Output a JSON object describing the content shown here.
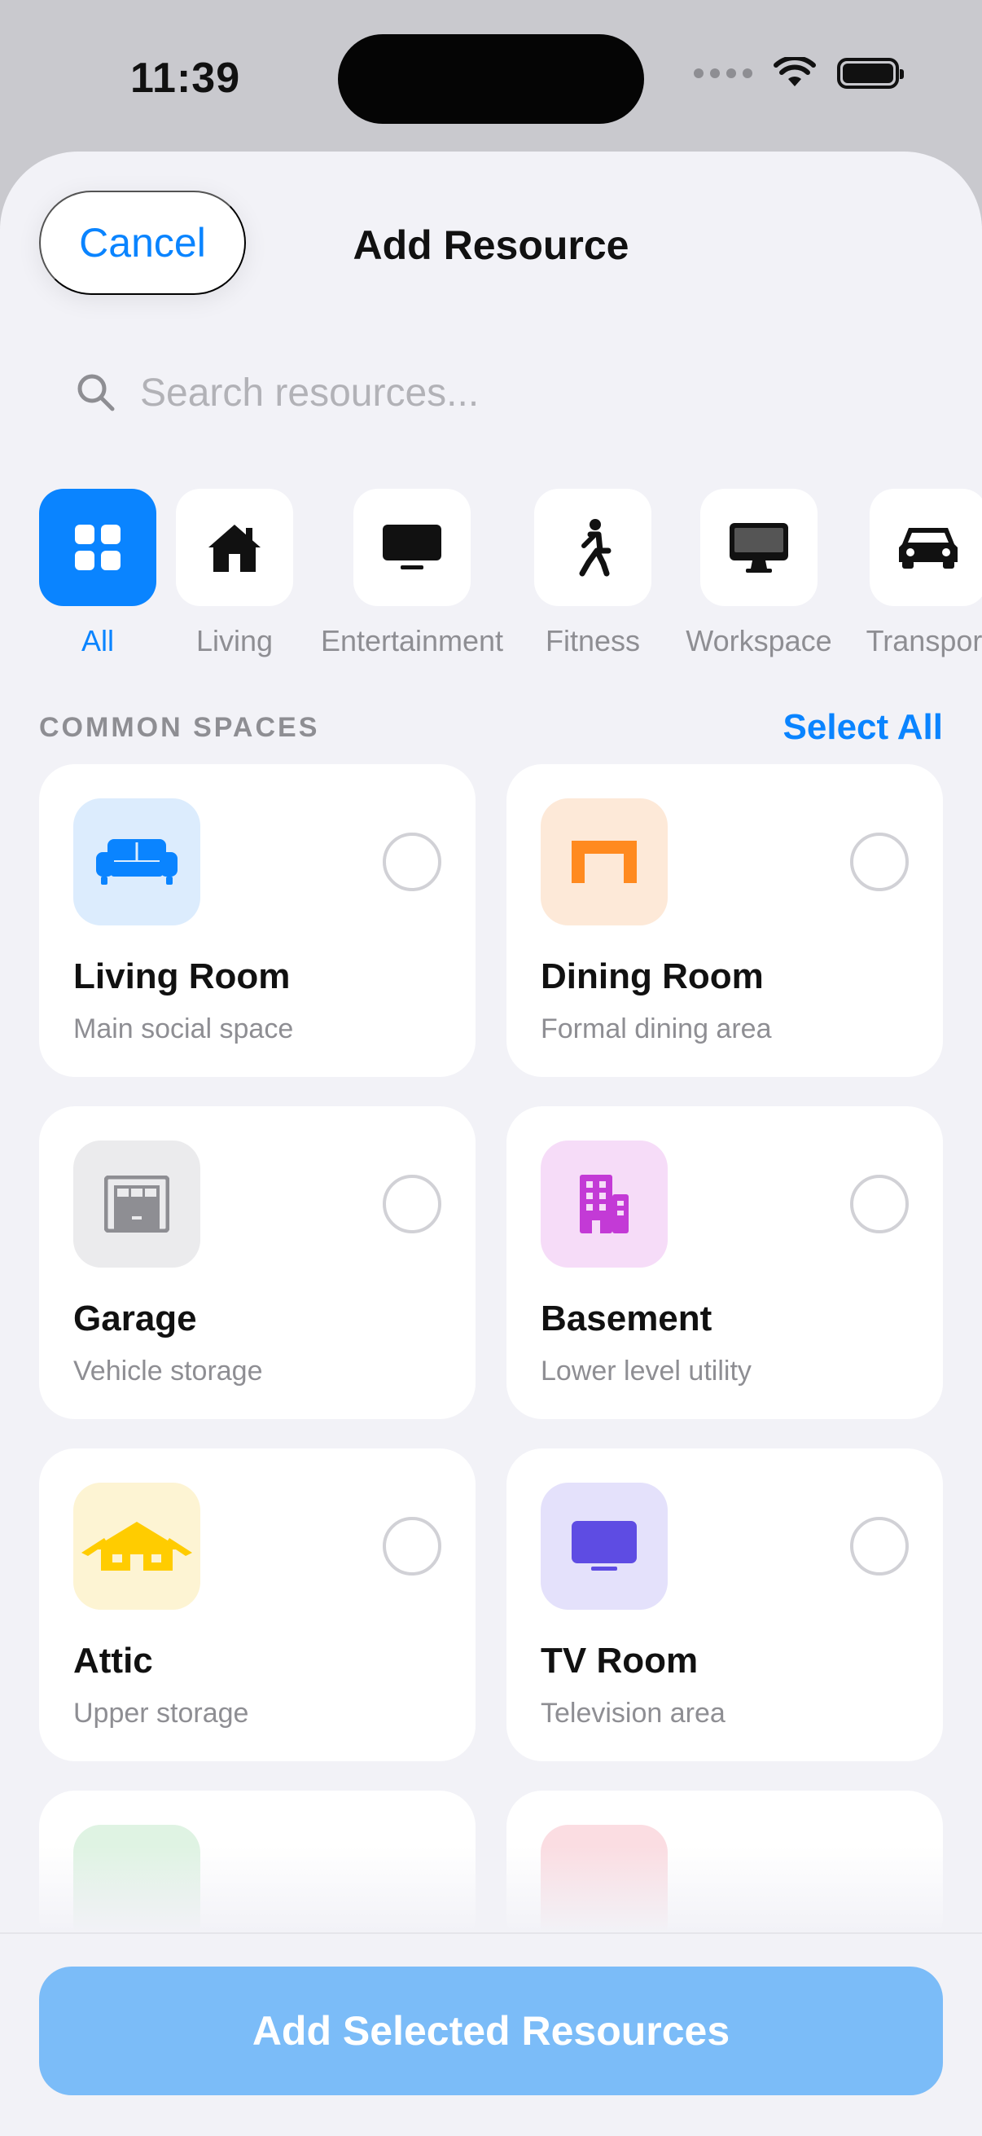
{
  "status_bar": {
    "time": "11:39"
  },
  "header": {
    "cancel_label": "Cancel",
    "title": "Add Resource"
  },
  "search": {
    "placeholder": "Search resources..."
  },
  "categories": [
    {
      "label": "All",
      "icon": "grid-icon",
      "selected": true
    },
    {
      "label": "Living",
      "icon": "house-icon"
    },
    {
      "label": "Entertainment",
      "icon": "tv-icon"
    },
    {
      "label": "Fitness",
      "icon": "walking-person-icon"
    },
    {
      "label": "Workspace",
      "icon": "desktop-computer-icon"
    },
    {
      "label": "Transport",
      "icon": "car-icon"
    }
  ],
  "section": {
    "title": "COMMON SPACES",
    "action": "Select All"
  },
  "resources": [
    {
      "name": "Living Room",
      "description": "Main social space",
      "icon": "sofa-icon",
      "color": "#0a84ff",
      "bg": "#dcecfd"
    },
    {
      "name": "Dining Room",
      "description": "Formal dining area",
      "icon": "table-icon",
      "color": "#ff8a1f",
      "bg": "#fde9d8"
    },
    {
      "name": "Garage",
      "description": "Vehicle storage",
      "icon": "garage-icon",
      "color": "#8e8e93",
      "bg": "#ebebed"
    },
    {
      "name": "Basement",
      "description": "Lower level utility",
      "icon": "building-icon",
      "color": "#c33ad6",
      "bg": "#f6dcf8"
    },
    {
      "name": "Attic",
      "description": "Upper storage",
      "icon": "roof-house-icon",
      "color": "#ffcc00",
      "bg": "#fdf4d3"
    },
    {
      "name": "TV Room",
      "description": "Television area",
      "icon": "tv-icon",
      "color": "#5e4ce3",
      "bg": "#e4e1fb"
    }
  ],
  "footer": {
    "add_label": "Add Selected Resources"
  }
}
